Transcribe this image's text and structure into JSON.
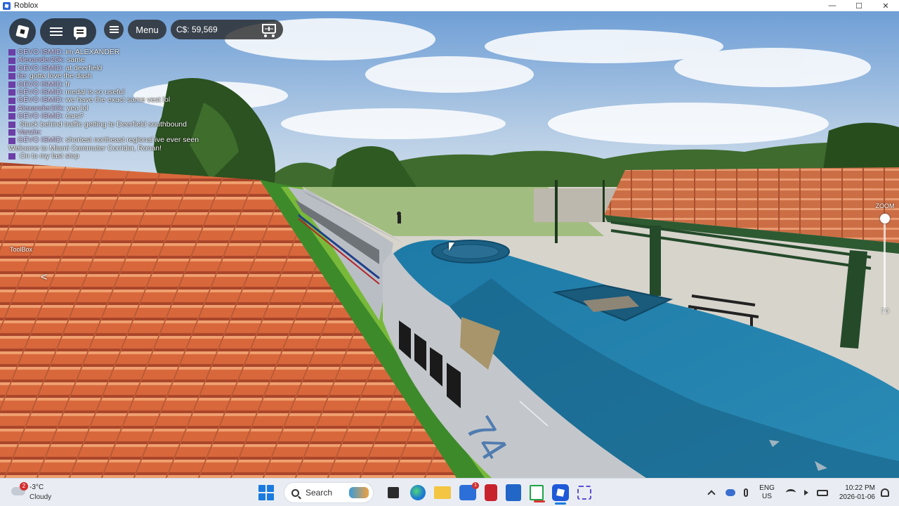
{
  "window": {
    "title": "Roblox",
    "controls": [
      "—",
      "☐",
      "✕"
    ]
  },
  "hud": {
    "menu_label": "Menu",
    "currency": "C$: 59,569",
    "toolbox_label": "ToolBox",
    "toolbox_arrow": "<",
    "zoom_label": "ZOOM",
    "zoom_value": "70"
  },
  "chat": [
    {
      "name": "GEVO ISMID:",
      "text": "im ALEXANDER"
    },
    {
      "name": "Alexander20k:",
      "text": "same"
    },
    {
      "name": "GEVO ISMID:",
      "text": "at deerfield"
    },
    {
      "name": "tie:",
      "text": "gotta love the dash"
    },
    {
      "name": "GEVO ISMID:",
      "text": "fr"
    },
    {
      "name": "GEVO ISMID:",
      "text": "medal is so useful"
    },
    {
      "name": "GEVO ISMID:",
      "text": "we have the exact same vest lol"
    },
    {
      "name": "Alexander20k:",
      "text": "yea lol"
    },
    {
      "name": "GEVO ISMID:",
      "text": "cars?"
    },
    {
      "name": "",
      "text": "Stuck behind traffic getting to Deerfield southbound"
    },
    {
      "name": "Vanzie:",
      "text": ""
    },
    {
      "name": "GEVO ISMID:",
      "text": "shortest northeast regional ive ever seen"
    },
    {
      "name": "",
      "text": "Welcome to Miami Commuter Corridor, Ronan!",
      "system": true
    },
    {
      "name": "",
      "text": "On to my last stop"
    }
  ],
  "scene": {
    "locomotive_number": "74",
    "colors": {
      "sky_top": "#6f9fd6",
      "sky_bottom": "#d8e3ee",
      "roof_tile": "#d9693a",
      "locomotive_blue": "#1f6e97",
      "coach_silver": "#b9bec4"
    }
  },
  "taskbar": {
    "weather_temp": "-3°C",
    "weather_condition": "Cloudy",
    "weather_badge": "2",
    "search_placeholder": "Search",
    "store_badge": "1",
    "language_line1": "ENG",
    "language_line2": "US",
    "time": "10:22 PM",
    "date": "2026-01-06"
  }
}
